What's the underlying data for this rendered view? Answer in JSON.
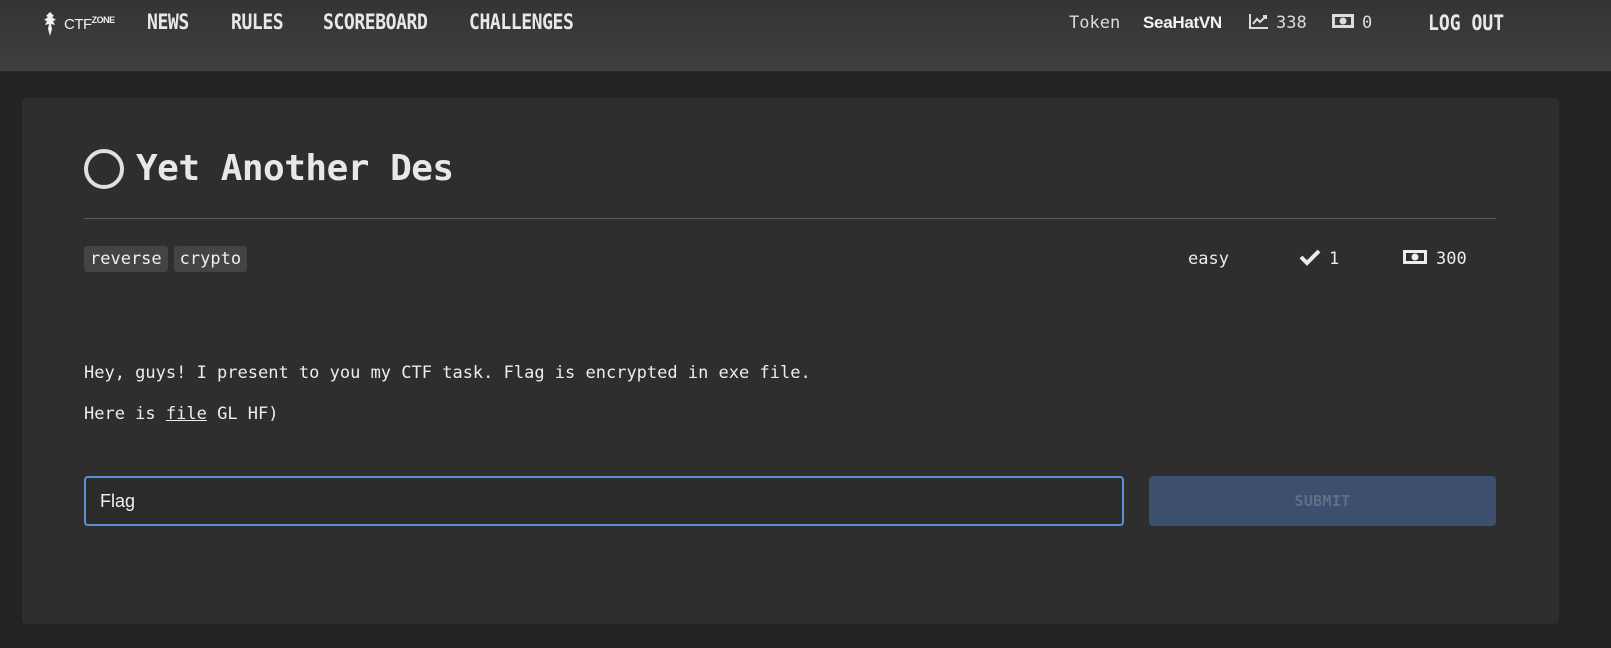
{
  "header": {
    "logo_text": "CTF",
    "logo_sup": "ZONE",
    "nav": [
      "NEWS",
      "RULES",
      "SCOREBOARD",
      "CHALLENGES"
    ],
    "token_label": "Token",
    "username": "SeaHatVN",
    "score": "338",
    "money": "0",
    "logout_label": "LOG OUT"
  },
  "challenge": {
    "title": "Yet Another Des",
    "status_icon": "circle-icon",
    "tags": [
      "reverse",
      "crypto"
    ],
    "difficulty": "easy",
    "solves": "1",
    "points": "300",
    "description_line1": "Hey, guys! I present to you my CTF task. Flag is encrypted in exe file.",
    "description_line2_prefix": "Here is ",
    "description_link": "file",
    "description_line2_suffix": " GL HF)"
  },
  "form": {
    "flag_placeholder": "Flag",
    "submit_label": "SUBMIT"
  },
  "colors": {
    "background": "#232323",
    "card": "#2e2e2e",
    "input_border": "#5b8fd6",
    "submit_bg": "#3d4f6e"
  }
}
